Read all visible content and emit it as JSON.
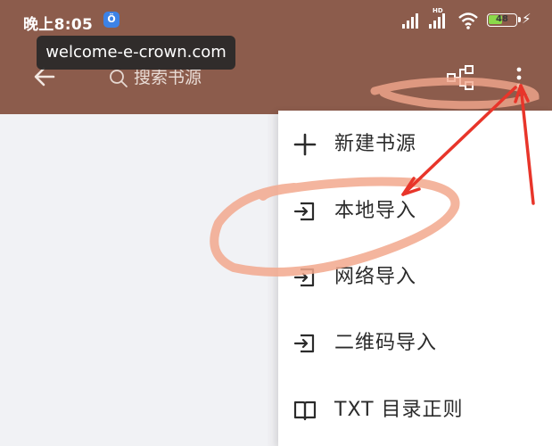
{
  "status_bar": {
    "time": "晚上8:05",
    "notification_badge": "Ö",
    "signal_label": "HD",
    "battery_level": "48",
    "battery_fraction": 0.48
  },
  "browser_overlay": {
    "url": "welcome-e-crown.com"
  },
  "toolbar": {
    "back_icon": "arrow-left-icon",
    "search_placeholder": "搜索书源",
    "tree_icon": "tree-group-icon",
    "more_icon": "more-vertical-icon"
  },
  "menu": {
    "items": [
      {
        "label": "新建书源",
        "icon": "plus-icon"
      },
      {
        "label": "本地导入",
        "icon": "import-icon"
      },
      {
        "label": "网络导入",
        "icon": "import-icon"
      },
      {
        "label": "二维码导入",
        "icon": "import-icon"
      },
      {
        "label": "TXT 目录正则",
        "icon": "book-icon"
      }
    ]
  },
  "colors": {
    "toolbar_bg": "#8c5c4c",
    "menu_bg": "#ffffff",
    "annotation_arrow": "#e8352a",
    "annotation_scribble": "#f2a88d"
  }
}
